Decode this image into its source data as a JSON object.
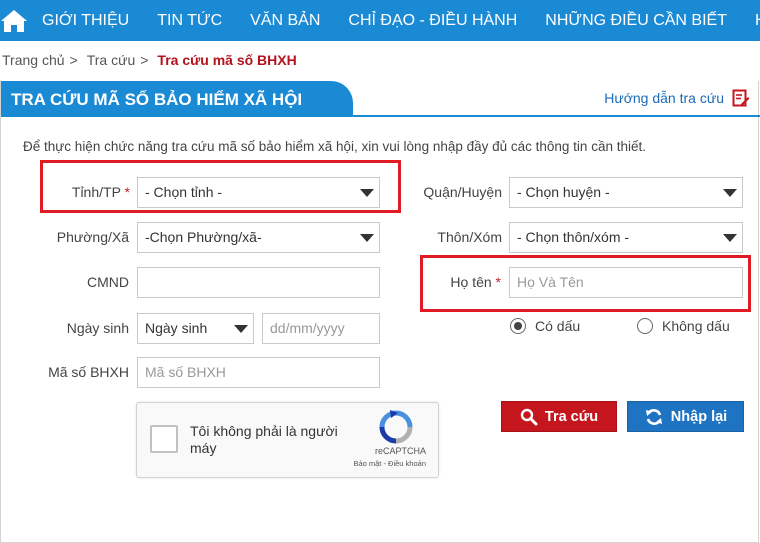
{
  "nav": {
    "items": [
      "GIỚI THIỆU",
      "TIN TỨC",
      "VĂN BẢN",
      "CHỈ ĐẠO - ĐIỀU HÀNH",
      "NHỮNG ĐIỀU CẦN BIẾT",
      "HỎ"
    ],
    "color": "#1a8ad5"
  },
  "breadcrumb": {
    "home": "Trang chủ",
    "section": "Tra cứu",
    "separator": ">",
    "current": "Tra cứu mã số BHXH"
  },
  "panel": {
    "title": "TRA CỨU MÃ SỐ BẢO HIỂM XÃ HỘI",
    "guide_link": "Hướng dẫn tra cứu"
  },
  "intro": "Để thực hiện chức năng tra cứu mã số bảo hiểm xã hội, xin vui lòng nhập đầy đủ các thông tin cần thiết.",
  "form": {
    "required_mark": "*",
    "province": {
      "label": "Tỉnh/TP",
      "value": "- Chọn tỉnh -"
    },
    "district": {
      "label": "Quận/Huyện",
      "value": "- Chọn huyện -"
    },
    "ward": {
      "label": "Phường/Xã",
      "value": "-Chọn Phường/xã-"
    },
    "hamlet": {
      "label": "Thôn/Xóm",
      "value": "- Chọn thôn/xóm -"
    },
    "id_card": {
      "label": "CMND",
      "value": ""
    },
    "full_name": {
      "label": "Họ tên",
      "placeholder": "Họ Và Tên"
    },
    "dob": {
      "label": "Ngày sinh",
      "type_value": "Ngày sinh",
      "placeholder": "dd/mm/yyyy"
    },
    "accent": {
      "with_accent": "Có dấu",
      "without_accent": "Không dấu",
      "selected": "with_accent"
    },
    "bhxh_code": {
      "label": "Mã số BHXH",
      "placeholder": "Mã số BHXH"
    }
  },
  "captcha": {
    "text": "Tôi không phải là người máy",
    "brand": "reCAPTCHA",
    "links": "Bảo mật - Điều khoản"
  },
  "buttons": {
    "search": "Tra cứu",
    "reset": "Nhập lại"
  },
  "colors": {
    "primary": "#1a8ad5",
    "danger": "#c4161c",
    "reset": "#1f73c3",
    "highlight": "#e01b24"
  }
}
